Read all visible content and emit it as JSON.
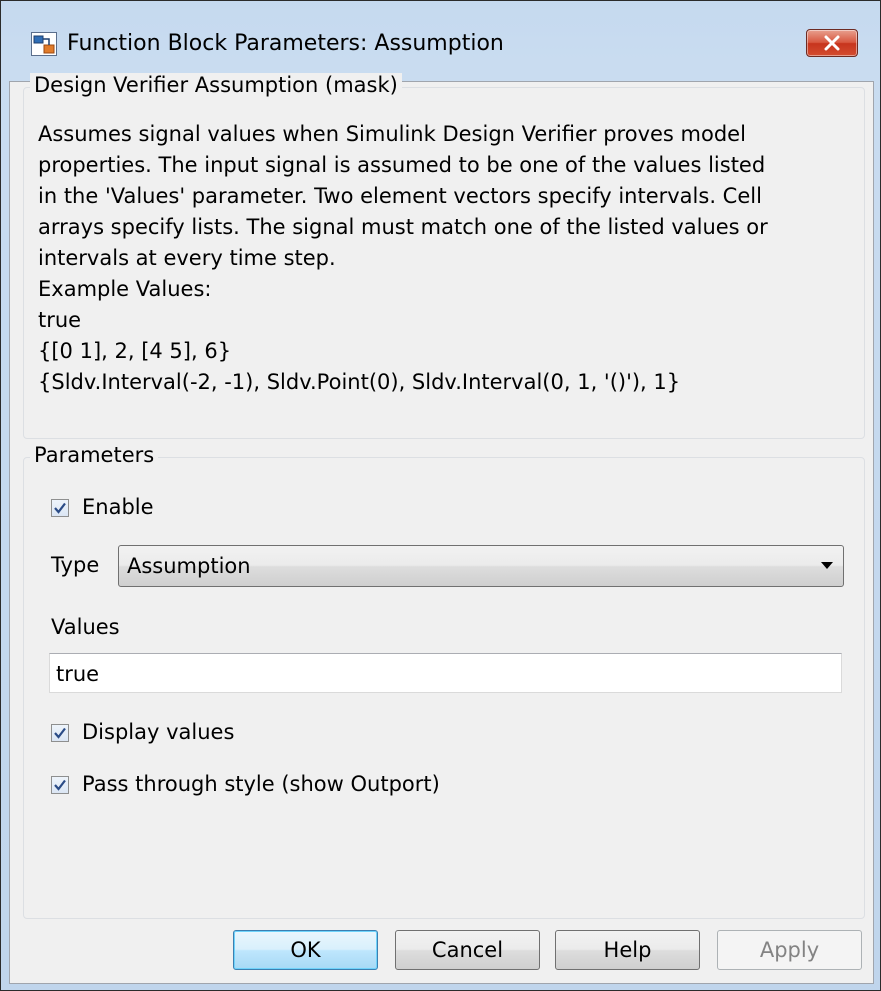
{
  "window": {
    "title": "Function Block Parameters: Assumption",
    "app_icon": "simulink-block-icon",
    "close_icon": "close-icon"
  },
  "mask_group": {
    "title": "Design Verifier Assumption (mask)",
    "description": "Assumes signal values when Simulink Design Verifier proves model\nproperties.  The input signal is assumed to be one of the values listed\nin the 'Values' parameter.  Two element vectors specify intervals.  Cell\narrays specify lists. The signal must match one of the listed values or\nintervals at every time step.\nExample Values:\ntrue\n{[0 1], 2, [4 5], 6}\n{Sldv.Interval(-2, -1), Sldv.Point(0), Sldv.Interval(0, 1, '()'), 1}"
  },
  "parameters_group": {
    "title": "Parameters",
    "enable": {
      "label": "Enable",
      "checked": true
    },
    "type": {
      "label": "Type",
      "value": "Assumption"
    },
    "values": {
      "label": "Values",
      "value": "true"
    },
    "display_values": {
      "label": "Display values",
      "checked": true
    },
    "pass_through": {
      "label": "Pass through style (show Outport)",
      "checked": true
    }
  },
  "buttons": {
    "ok": "OK",
    "cancel": "Cancel",
    "help": "Help",
    "apply": "Apply"
  },
  "colors": {
    "titlebar": "#c5d9ef",
    "dialog_bg": "#f0f0f0",
    "close_red": "#c7341d",
    "checkmark": "#2a4b86"
  }
}
